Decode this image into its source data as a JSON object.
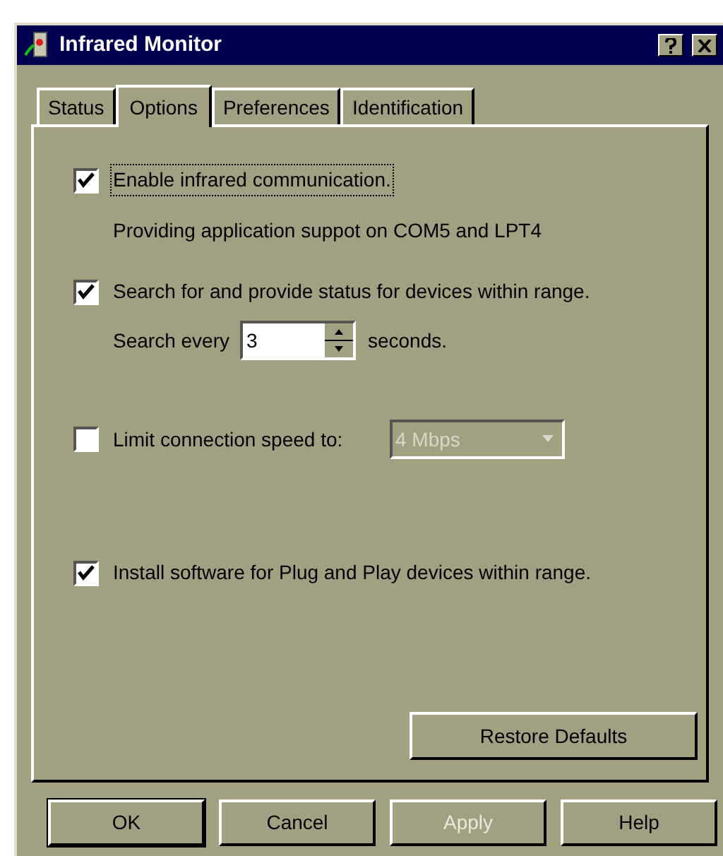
{
  "window": {
    "title": "Infrared Monitor"
  },
  "tabs": [
    {
      "label": "Status",
      "selected": false
    },
    {
      "label": "Options",
      "selected": true
    },
    {
      "label": "Preferences",
      "selected": false
    },
    {
      "label": "Identification",
      "selected": false
    }
  ],
  "options": [
    {
      "kind": "checkbox",
      "label": "Enable infrared communication.",
      "checked": true,
      "focused": true
    },
    {
      "kind": "text",
      "label": "Providing application suppot on COM5 and LPT4"
    },
    {
      "kind": "checkbox",
      "label": "Search for and provide status for devices within range.",
      "checked": true,
      "focused": false
    },
    {
      "kind": "spin",
      "label": "Search every",
      "value": "3",
      "suffix": "seconds."
    },
    {
      "kind": "combo",
      "label": "Limit connection speed to:",
      "checked": false,
      "value": "4 Mbps",
      "disabled": true
    },
    {
      "kind": "checkbox",
      "label": "Install software for Plug and Play devices within range.",
      "checked": true,
      "focused": false
    }
  ],
  "restore_button": "Restore Defaults",
  "buttons": [
    {
      "label": "OK",
      "disabled": false,
      "default": true
    },
    {
      "label": "Cancel",
      "disabled": false,
      "default": false
    },
    {
      "label": "Apply",
      "disabled": true,
      "default": false
    },
    {
      "label": "Help",
      "disabled": false,
      "default": false
    }
  ]
}
